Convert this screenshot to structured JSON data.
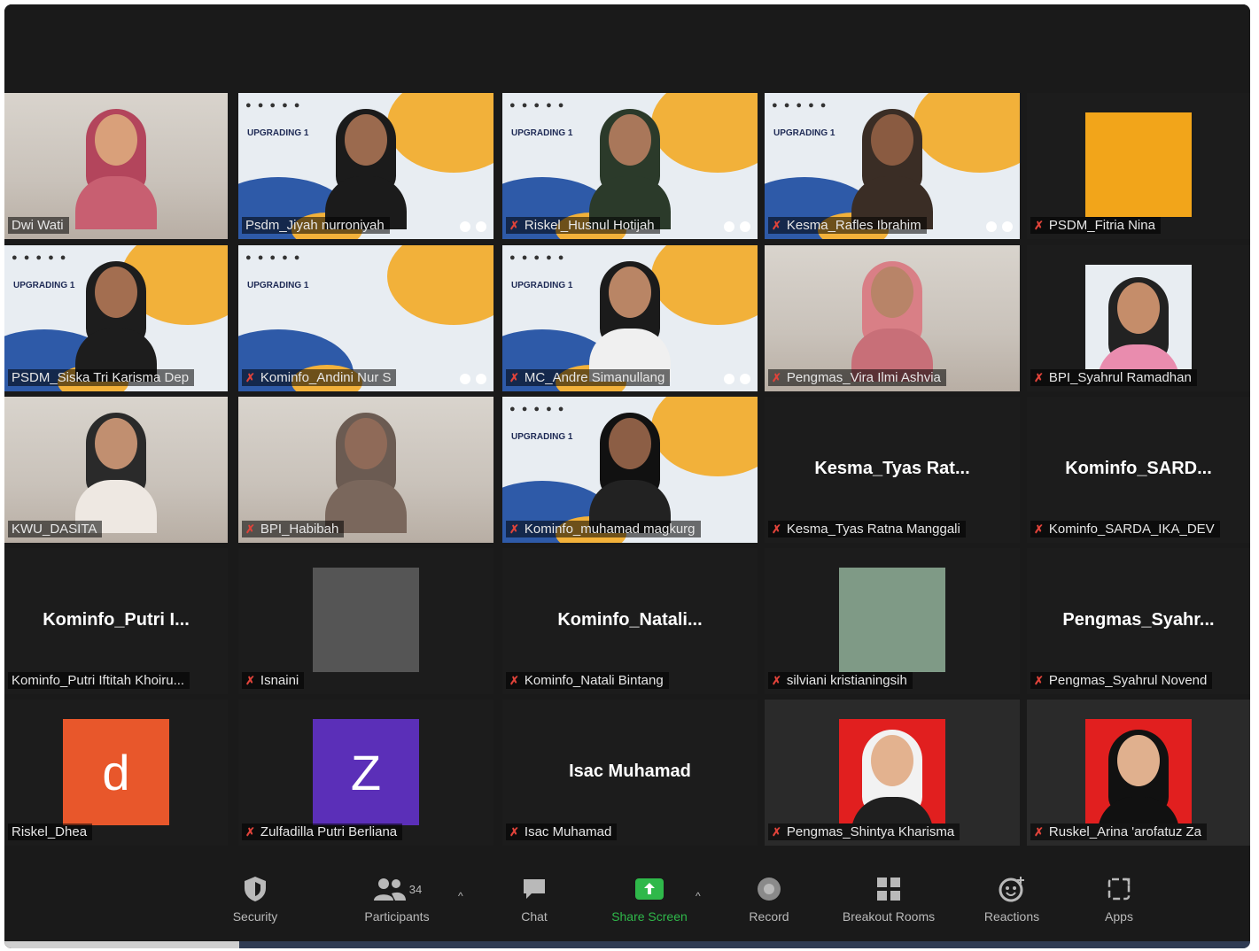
{
  "tiles": [
    {
      "name": "Dwi Wati",
      "kind": "room",
      "skin": "#d9a07a",
      "hijab": "#b3455c",
      "shirt": "#c85f71",
      "active": true,
      "muted": false
    },
    {
      "name": "Psdm_Jiyah nurroniyah",
      "kind": "card",
      "skin": "#9b6a4e",
      "hijab": "#1b1b1b",
      "shirt": "#1b1b1b",
      "muted": false,
      "dots": true
    },
    {
      "name": "Riskel_Husnul Hotijah",
      "kind": "card",
      "skin": "#a9775a",
      "hijab": "#2b3a2a",
      "shirt": "#2b3a2a",
      "muted": true,
      "dots": true
    },
    {
      "name": "Kesma_Rafles Ibrahim",
      "kind": "card",
      "skin": "#8a5b41",
      "hijab": "#3a2d25",
      "shirt": "#3a2d25",
      "muted": true,
      "dots": true
    },
    {
      "name": "PSDM_Fitria Nina",
      "kind": "thumb",
      "thumbcolor": "#f2a51a",
      "muted": true
    },
    {
      "name": "PSDM_Siska Tri Karisma Dep",
      "kind": "card",
      "skin": "#a36e50",
      "hijab": "#1d1d1d",
      "shirt": "#1d1d1d",
      "muted": false
    },
    {
      "name": "Kominfo_Andini Nur S",
      "kind": "card",
      "empty": true,
      "muted": true,
      "dots": true
    },
    {
      "name": "MC_Andre Simanullang",
      "kind": "card",
      "skin": "#b98565",
      "hijab": "#1b1b1b",
      "shirt": "#f0f0f0",
      "muted": true,
      "dots": true
    },
    {
      "name": "Pengmas_Vira Ilmi Ashvia",
      "kind": "room",
      "skin": "#b88468",
      "hijab": "#d97f86",
      "shirt": "#c86f78",
      "muted": true
    },
    {
      "name": "BPI_Syahrul Ramadhan",
      "kind": "thumbperson",
      "skin": "#c58d6a",
      "shirt": "#e98cae",
      "muted": true
    },
    {
      "name": "KWU_DASITA",
      "kind": "room",
      "skin": "#c18f70",
      "hijab": "#2a2a2a",
      "shirt": "#eee8e2",
      "muted": false
    },
    {
      "name": "BPI_Habibah",
      "kind": "room",
      "skin": "#8f6a58",
      "hijab": "#6b5b52",
      "shirt": "#7a675c",
      "muted": true
    },
    {
      "name": "Kominfo_muhamad magkurg",
      "kind": "card",
      "skin": "#8c5e45",
      "hijab": "#111111",
      "shirt": "#222222",
      "muted": true
    },
    {
      "name": "Kesma_Tyas Ratna Manggali",
      "kind": "text",
      "big": "Kesma_Tyas  Rat...",
      "muted": true
    },
    {
      "name": "Kominfo_SARDA_IKA_DEV",
      "kind": "text",
      "big": "Kominfo_SARD...",
      "muted": true
    },
    {
      "name": "Kominfo_Putri Iftitah Khoiru...",
      "kind": "text",
      "big": "Kominfo_Putri  I...",
      "muted": false
    },
    {
      "name": "Isnaini",
      "kind": "thumb",
      "thumbcolor": "#555555",
      "muted": true
    },
    {
      "name": "Kominfo_Natali Bintang",
      "kind": "text",
      "big": "Kominfo_Natali...",
      "muted": true
    },
    {
      "name": "silviani kristianingsih",
      "kind": "thumb",
      "thumbcolor": "#7f9a86",
      "muted": true
    },
    {
      "name": "Pengmas_Syahrul Novend",
      "kind": "text",
      "big": "Pengmas_Syahr...",
      "muted": true
    },
    {
      "name": "Riskel_Dhea",
      "kind": "letter",
      "letter": "d",
      "lettercolor": "#e8572b",
      "muted": false
    },
    {
      "name": "Zulfadilla Putri Berliana",
      "kind": "letter",
      "letter": "Z",
      "lettercolor": "#5b2fb8",
      "muted": true
    },
    {
      "name": "Isac Muhamad",
      "kind": "text",
      "big": "Isac Muhamad",
      "muted": true
    },
    {
      "name": "Pengmas_Shintya Kharisma",
      "kind": "photo",
      "bg": "#e11f1f",
      "hijab": "#f2f2f2",
      "skin": "#e3b28f",
      "shirt": "#1f1f1f",
      "muted": true
    },
    {
      "name": "Ruskel_Arina 'arofatuz Za",
      "kind": "photo",
      "bg": "#e11f1f",
      "hijab": "#111111",
      "skin": "#e0b08e",
      "shirt": "#111111",
      "muted": true
    }
  ],
  "card": {
    "heading": "UPGRADING 1"
  },
  "toolbar": {
    "security": "Security",
    "participants": "Participants",
    "participants_count": "34",
    "chat": "Chat",
    "share": "Share Screen",
    "record": "Record",
    "breakout": "Breakout Rooms",
    "reactions": "Reactions",
    "apps": "Apps"
  },
  "colors": {
    "active_border": "#c6e34a",
    "share_green": "#2fb84a",
    "muted_red": "#e0433a",
    "app_bg": "#1a1a1a"
  }
}
